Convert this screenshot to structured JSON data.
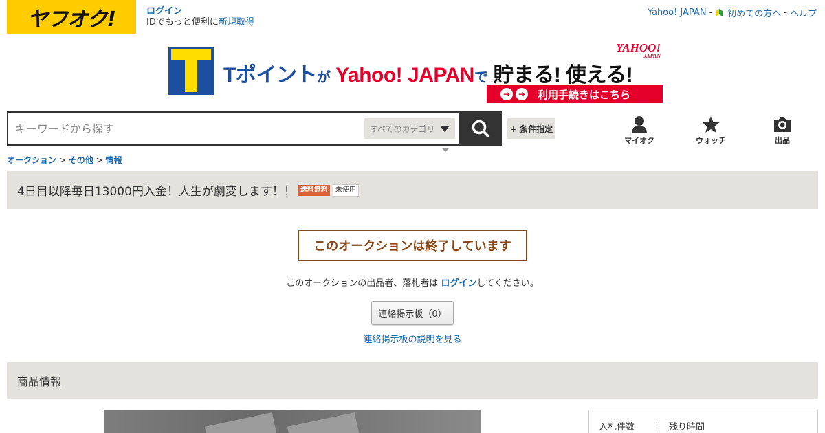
{
  "header": {
    "logo_text": "ヤフオク!",
    "login_label": "ログイン",
    "login_sub_prefix": "IDでもっと便利に",
    "register_label": "新規取得",
    "top_links": [
      "Yahoo! JAPAN",
      "初めての方へ",
      "ヘルプ"
    ],
    "separator": "-"
  },
  "banner": {
    "tpoint": "Tポイント",
    "ga": "が",
    "yahoo_japan": "Yahoo! JAPAN",
    "de": "で",
    "slogan": "貯まる! 使える!",
    "mini_logo": "YAHOO!",
    "mini_logo_sub": "JAPAN",
    "cta_label": "利用手続きはこちら"
  },
  "search": {
    "placeholder": "キーワードから探す",
    "category_label": "すべてのカテゴリ",
    "condition_button": "+ 条件指定"
  },
  "nav": {
    "my_auction": "マイオク",
    "watch": "ウォッチ",
    "sell": "出品"
  },
  "breadcrumb": {
    "items": [
      "オークション",
      "その他",
      "情報"
    ],
    "separator": ">"
  },
  "item": {
    "title": "4日目以降毎日13000円入金！人生が劇変します！！",
    "badge_shipping": "送料無料",
    "badge_condition": "未使用",
    "ended_message": "このオークションは終了しています",
    "notice_prefix": "このオークションの出品者、落札者は",
    "notice_login": "ログイン",
    "notice_suffix": "してください。",
    "board_button": "連絡掲示板（0）",
    "board_help": "連絡掲示板の説明を見る"
  },
  "product_info": {
    "section_title": "商品情報",
    "bid_count_label": "入札件数",
    "time_left_label": "残り時間"
  },
  "colors": {
    "brand_yellow": "#ffcc00",
    "link_blue": "#1a6bb0",
    "ended_brown": "#8a4513",
    "bar_gray": "#e3e2dc",
    "badge_orange": "#d9633b",
    "yahoo_red": "#e4002b"
  }
}
